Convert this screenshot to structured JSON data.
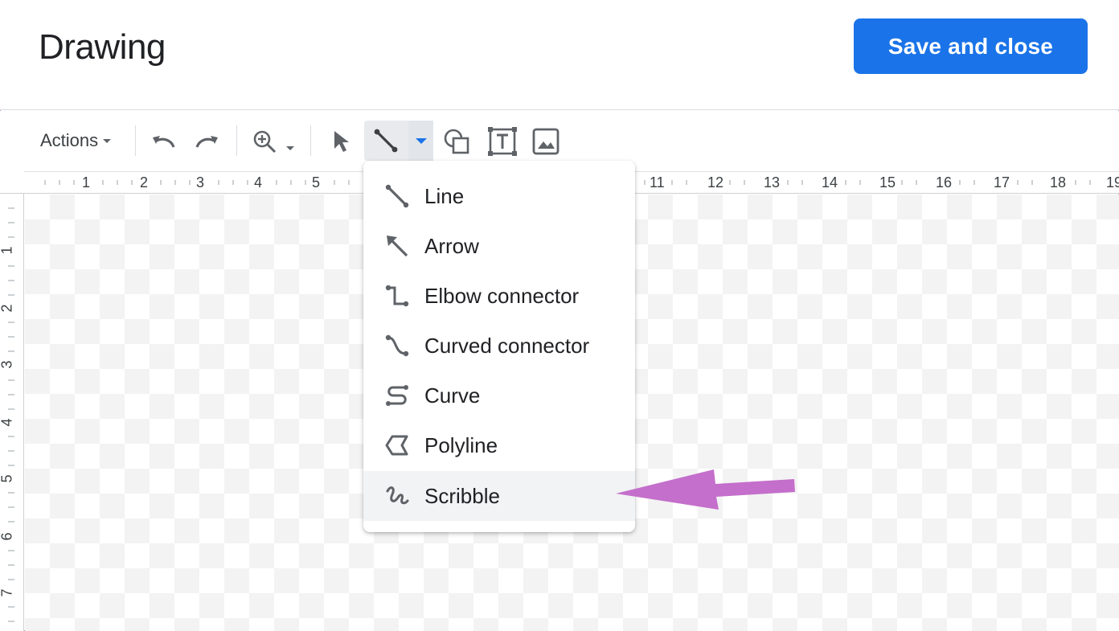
{
  "header": {
    "title": "Drawing",
    "save_label": "Save and close"
  },
  "toolbar": {
    "actions_label": "Actions",
    "icons": [
      "undo-icon",
      "redo-icon",
      "zoom-icon",
      "select-icon",
      "line-icon",
      "shape-icon",
      "textbox-icon",
      "image-icon"
    ]
  },
  "ruler": {
    "top": [
      "1",
      "2",
      "3",
      "4",
      "5",
      "11",
      "12",
      "13",
      "14",
      "15",
      "16",
      "17",
      "18",
      "19"
    ],
    "left": [
      "1",
      "2",
      "3",
      "4",
      "5",
      "6",
      "7"
    ]
  },
  "menu": {
    "items": [
      {
        "label": "Line",
        "icon": "line-icon"
      },
      {
        "label": "Arrow",
        "icon": "arrow-icon"
      },
      {
        "label": "Elbow connector",
        "icon": "elbow-connector-icon"
      },
      {
        "label": "Curved connector",
        "icon": "curved-connector-icon"
      },
      {
        "label": "Curve",
        "icon": "curve-icon"
      },
      {
        "label": "Polyline",
        "icon": "polyline-icon"
      },
      {
        "label": "Scribble",
        "icon": "scribble-icon",
        "highlighted": true
      }
    ]
  },
  "colors": {
    "accent": "#1a73e8",
    "pointer": "#c46fcb",
    "icon": "#5f6368"
  }
}
